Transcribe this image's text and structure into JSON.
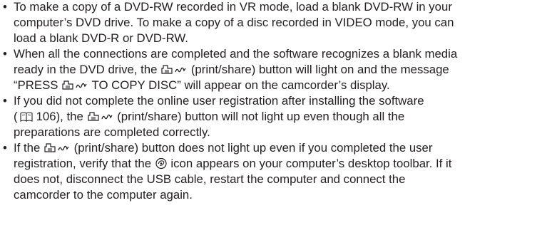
{
  "bullets": [
    {
      "marker": "•",
      "lines": [
        "To make a copy of a DVD-RW recorded in VR mode, load a blank DVD-RW in your",
        "computer’s DVD drive. To make a copy of a disc recorded in VIDEO mode, you can",
        "load a blank DVD-R or DVD-RW."
      ]
    },
    {
      "marker": "•",
      "line1": "When all the connections are completed and the software recognizes a blank media",
      "line2_a": "ready in the DVD drive, the",
      "line2_b": "(print/share) button will light on and the message",
      "line3_a": "“PRESS",
      "line3_b": "TO COPY DISC” will appear on the camcorder’s display."
    },
    {
      "marker": "•",
      "line1": "If you did not complete the online user registration after installing the software",
      "line2_a": "(",
      "line2_b": "106), the",
      "line2_c": "(print/share) button will not light up even though all the",
      "line3": "preparations are completed correctly."
    },
    {
      "marker": "•",
      "line1_a": "If the",
      "line1_b": "(print/share) button does not light up even if you completed the user",
      "line2_a": "registration, verify that the",
      "line2_b": "icon appears on your computer’s desktop toolbar. If it",
      "line3": "does not, disconnect the USB cable, restart the computer and connect the",
      "line4": "camcorder to the computer again."
    }
  ],
  "icons": {
    "print_share": "print-share-icon",
    "book": "book-reference-icon",
    "app": "desktop-app-icon"
  }
}
